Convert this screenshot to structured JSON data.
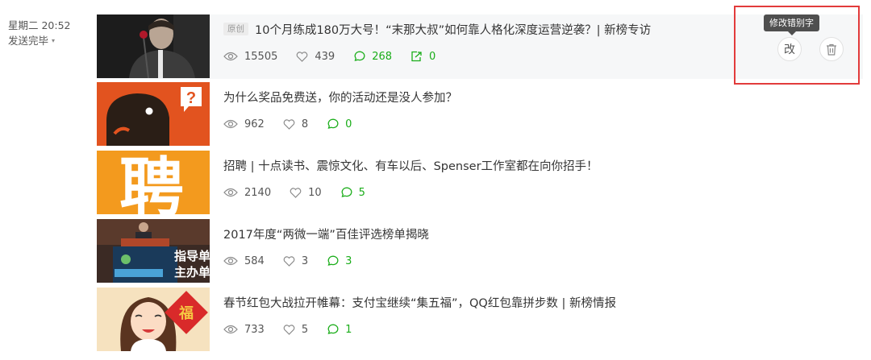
{
  "send_info": {
    "datetime": "星期二 20:52",
    "status": "发送完毕"
  },
  "colors": {
    "accent_green": "#1aad19",
    "highlight_red": "#e23b3b",
    "tooltip_bg": "#4f4f4f"
  },
  "articles": [
    {
      "tag": "原创",
      "title": "10个月练成180万大号！“末那大叔”如何靠人格化深度运营逆袭？| 新榜专访",
      "views": "15505",
      "likes": "439",
      "comments": "268",
      "shares": "0"
    },
    {
      "title": "为什么奖品免费送，你的活动还是没人参加？",
      "views": "962",
      "likes": "8",
      "comments": "0"
    },
    {
      "title": "招聘 | 十点读书、震惊文化、有车以后、Spenser工作室都在向你招手！",
      "views": "2140",
      "likes": "10",
      "comments": "5"
    },
    {
      "title": "2017年度“两微一端”百佳评选榜单揭晓",
      "views": "584",
      "likes": "3",
      "comments": "3"
    },
    {
      "title": "春节红包大战拉开帷幕：支付宝继续“集五福”，QQ红包靠拼步数 | 新榜情报",
      "views": "733",
      "likes": "5",
      "comments": "1"
    }
  ],
  "thumbnails": {
    "a2_bubble": "?",
    "a3_char": "聘",
    "a4_text1": "指导单",
    "a4_text2": "主办单",
    "a5_char": "福"
  },
  "actions": {
    "edit_label": "改",
    "edit_tooltip": "修改错别字",
    "delete_icon": "trash-icon"
  }
}
